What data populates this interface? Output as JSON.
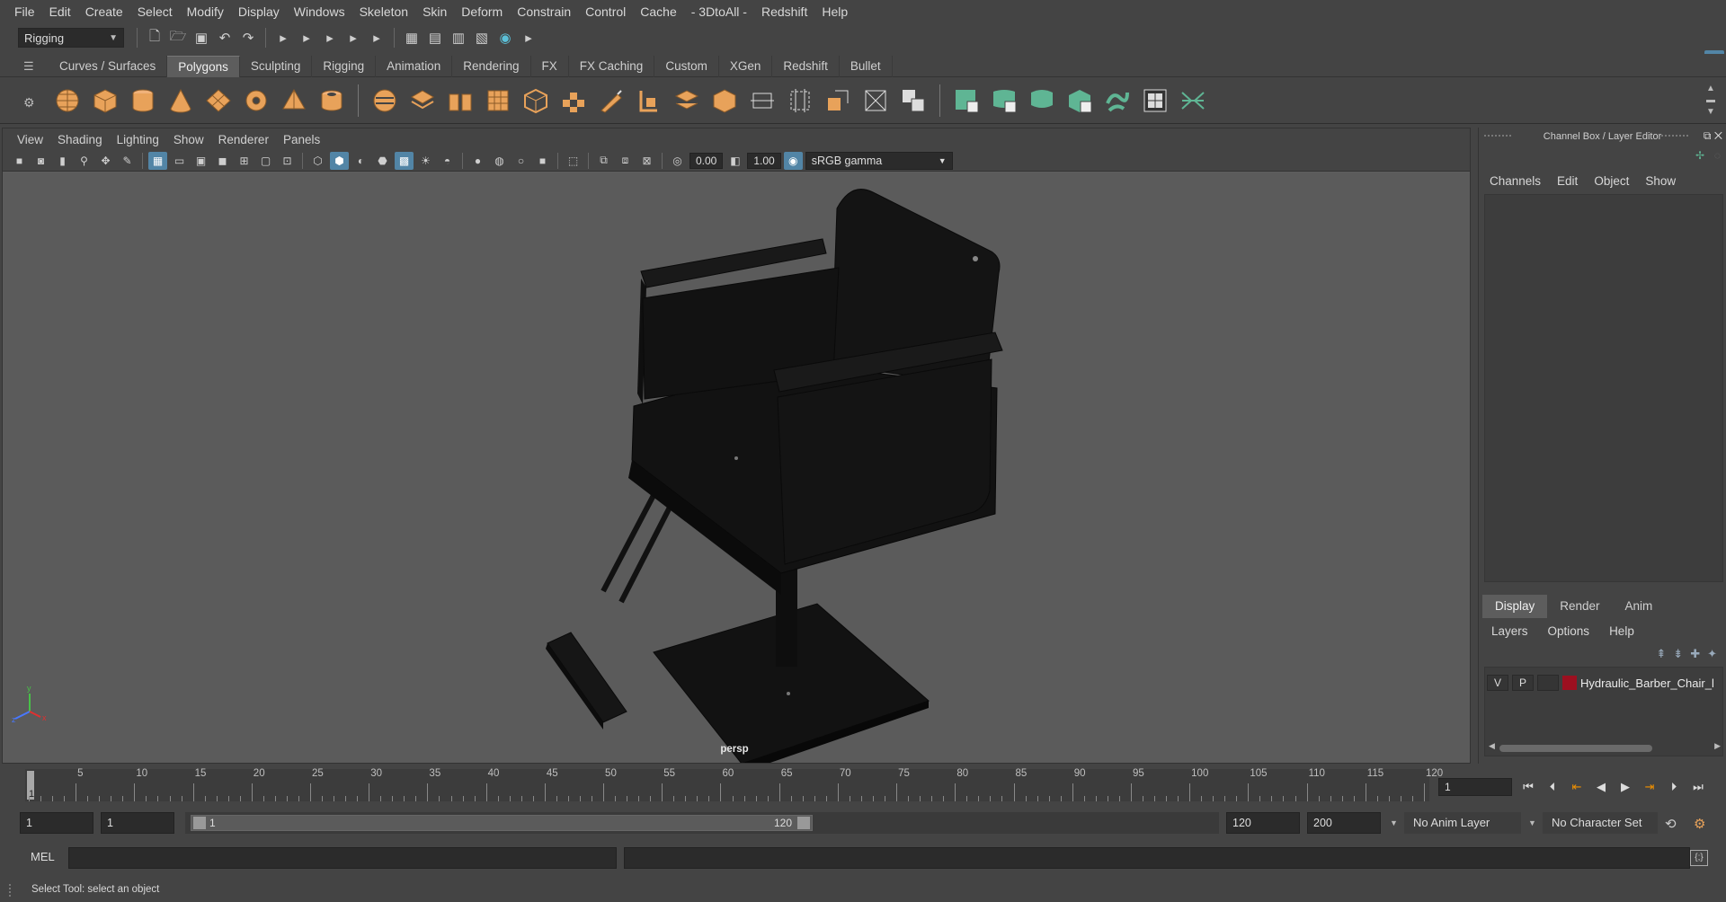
{
  "menubar": [
    "File",
    "Edit",
    "Create",
    "Select",
    "Modify",
    "Display",
    "Windows",
    "Skeleton",
    "Skin",
    "Deform",
    "Constrain",
    "Control",
    "Cache",
    "- 3DtoAll -",
    "Redshift",
    "Help"
  ],
  "status": {
    "mode": "Rigging"
  },
  "shelf_tabs": [
    "Curves / Surfaces",
    "Polygons",
    "Sculpting",
    "Rigging",
    "Animation",
    "Rendering",
    "FX",
    "FX Caching",
    "Custom",
    "XGen",
    "Redshift",
    "Bullet"
  ],
  "shelf_active": "Polygons",
  "viewport": {
    "menu": [
      "View",
      "Shading",
      "Lighting",
      "Show",
      "Renderer",
      "Panels"
    ],
    "exposure": "0.00",
    "gamma": "1.00",
    "color_space": "sRGB gamma",
    "camera_label": "persp",
    "axis": {
      "y": "y",
      "x": "x",
      "z": "z"
    }
  },
  "channel_box": {
    "title": "Channel Box / Layer Editor",
    "menu": [
      "Channels",
      "Edit",
      "Object",
      "Show"
    ]
  },
  "layer_editor": {
    "tabs": [
      "Display",
      "Render",
      "Anim"
    ],
    "active_tab": "Display",
    "menu": [
      "Layers",
      "Options",
      "Help"
    ],
    "layer": {
      "v": "V",
      "p": "P",
      "name": "Hydraulic_Barber_Chair_l",
      "color": "#9c1020"
    }
  },
  "timeline": {
    "ticks": [
      "5",
      "10",
      "15",
      "20",
      "25",
      "30",
      "35",
      "40",
      "45",
      "50",
      "55",
      "60",
      "65",
      "70",
      "75",
      "80",
      "85",
      "90",
      "95",
      "100",
      "105",
      "110",
      "115",
      "120"
    ],
    "current_frame_label": "1",
    "current_frame": "1"
  },
  "range": {
    "start": "1",
    "playback_start": "1",
    "range_start": "1",
    "range_end": "120",
    "playback_end": "120",
    "end": "200",
    "anim_layer": "No Anim Layer",
    "character_set": "No Character Set"
  },
  "command": {
    "lang": "MEL"
  },
  "help_line": "Select Tool: select an object",
  "colors": {
    "accent": "#5285a6",
    "shelf_orange": "#e8a25a",
    "shelf_green": "#5fb594",
    "layer_red": "#9c1020"
  }
}
